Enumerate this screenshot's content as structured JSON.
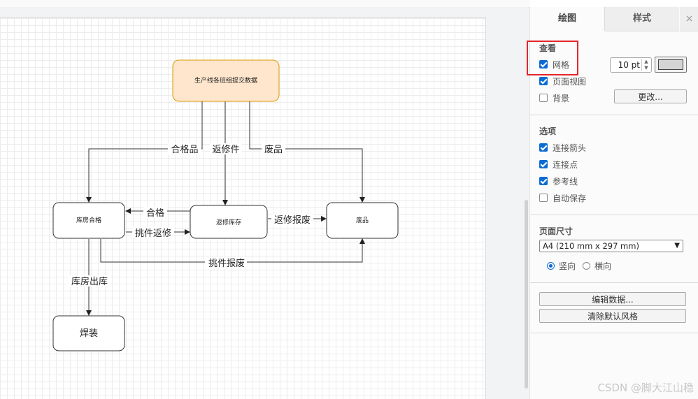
{
  "diagram": {
    "nodes": {
      "source": "生产线各班组提交数据",
      "warehouse_ok": "库房合格",
      "rework_store": "返修库存",
      "scrap": "废品",
      "welding": "焊装"
    },
    "edges": {
      "qualified": "合格品",
      "rework": "返修件",
      "scrap": "废品",
      "ok_back": "合格",
      "pick_rework": "挑件返修",
      "rework_scrap": "返修报废",
      "pick_scrap": "挑件报废",
      "out": "库房出库"
    },
    "colors": {
      "source_fill": "#ffe6cc",
      "source_stroke": "#d79b00"
    }
  },
  "panel": {
    "tabs": {
      "draw": "绘图",
      "style": "样式",
      "close": "×"
    },
    "view": {
      "title": "查看",
      "grid": "网格",
      "grid_checked": true,
      "grid_size": "10 pt",
      "page_view": "页面视图",
      "page_view_checked": true,
      "background": "背景",
      "background_checked": false,
      "change_button": "更改..."
    },
    "options": {
      "title": "选项",
      "items": [
        {
          "label": "连接箭头",
          "checked": true
        },
        {
          "label": "连接点",
          "checked": true
        },
        {
          "label": "参考线",
          "checked": true
        },
        {
          "label": "自动保存",
          "checked": false
        }
      ]
    },
    "page_size": {
      "title": "页面尺寸",
      "selected": "A4 (210 mm x 297 mm)",
      "portrait": "竖向",
      "landscape": "横向",
      "orientation": "portrait"
    },
    "actions": {
      "edit_data": "编辑数据...",
      "clear_style": "清除默认风格"
    },
    "highlight_color": "#e2262b",
    "accent_color": "#0b6bd3"
  },
  "watermark": "CSDN @脚大江山稳"
}
